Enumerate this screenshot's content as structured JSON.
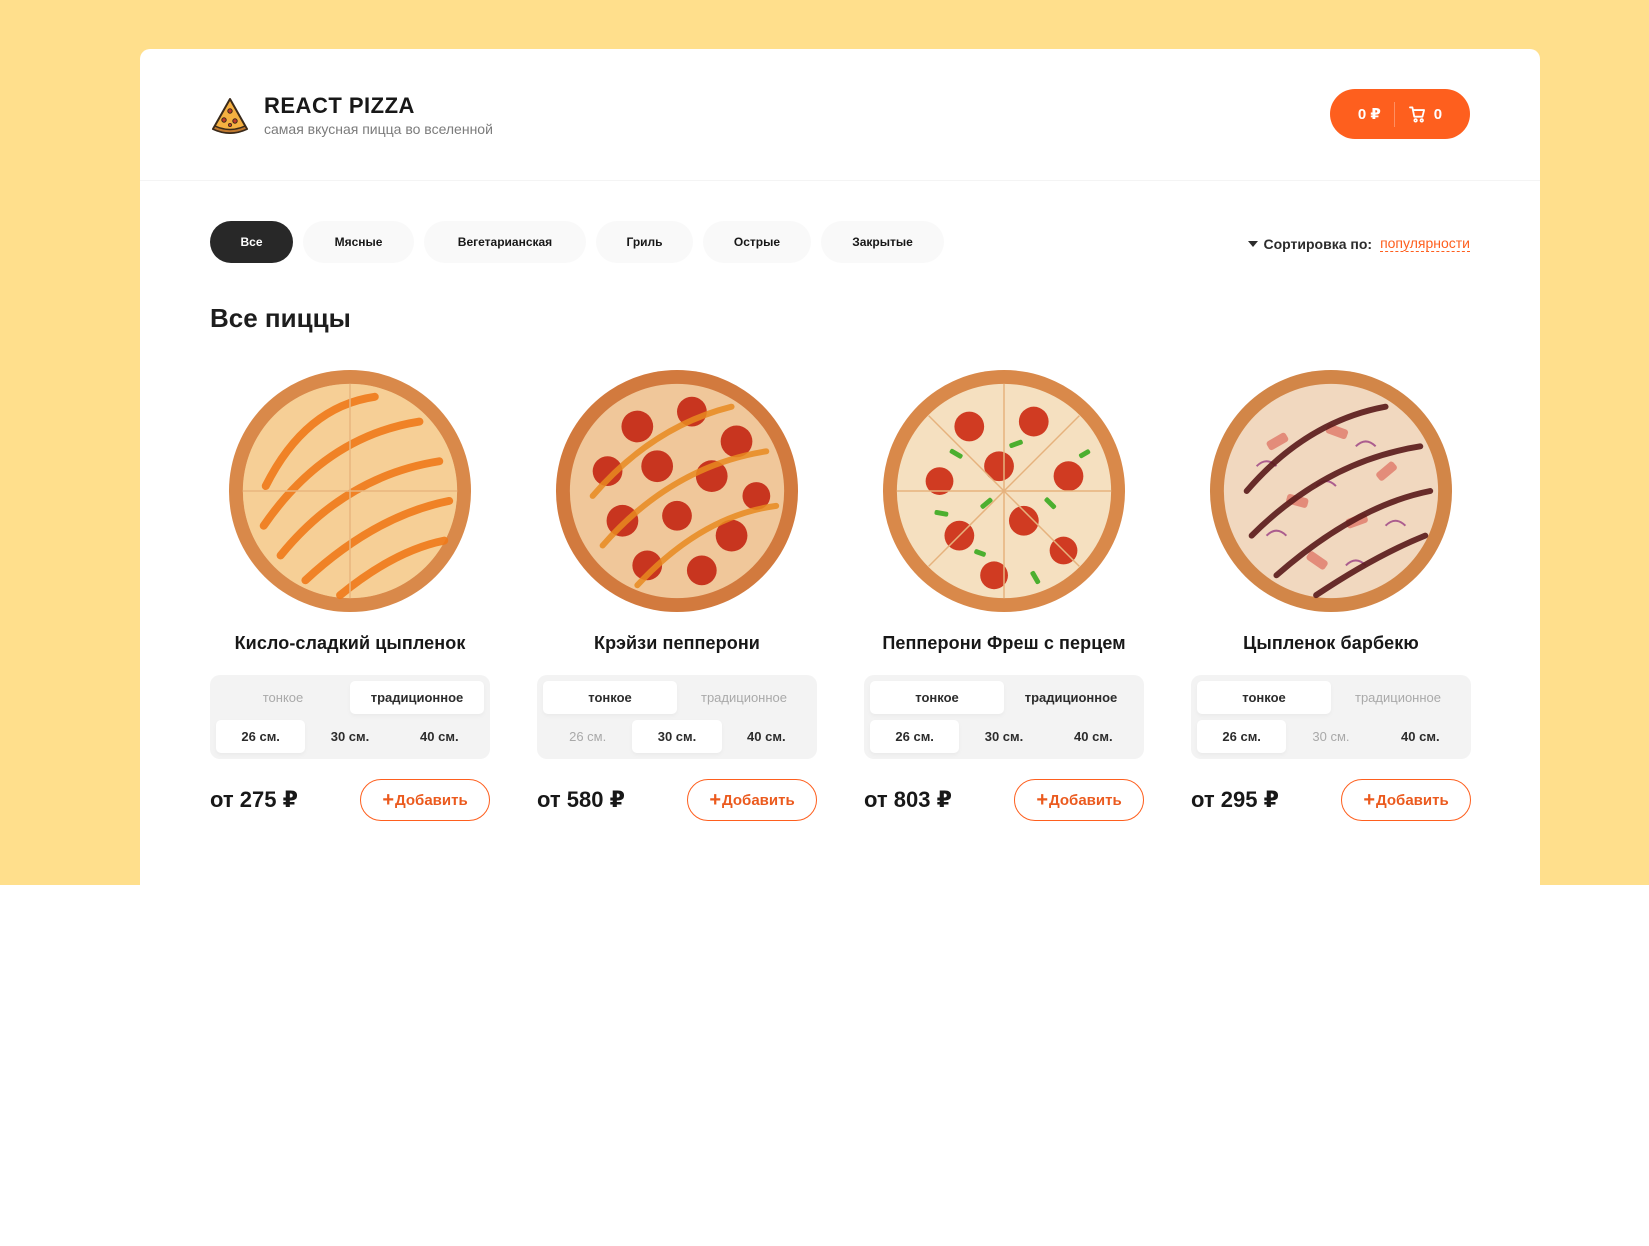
{
  "brand": {
    "title": "REACT PIZZA",
    "subtitle": "самая вкусная пицца во вселенной",
    "icon": "pizza-slice-icon"
  },
  "cart": {
    "price": "0 ₽",
    "count": "0",
    "icon": "cart-icon"
  },
  "categories": [
    "Все",
    "Мясные",
    "Вегетарианская",
    "Гриль",
    "Острые",
    "Закрытые"
  ],
  "active_category": "Все",
  "sort": {
    "label": "Сортировка по:",
    "value": "популярности",
    "icon": "caret-down-icon"
  },
  "section_title": "Все пиццы",
  "option_labels": {
    "types": [
      "тонкое",
      "традиционное"
    ],
    "sizes": [
      "26 см.",
      "30 см.",
      "40 см."
    ],
    "add": "Добавить",
    "add_icon": "plus-icon"
  },
  "pizzas": [
    {
      "title": "Кисло-сладкий цыпленок",
      "price": "от 275 ₽",
      "type_state": [
        "disabled",
        "active"
      ],
      "size_state": [
        "active",
        "normal",
        "normal"
      ],
      "style": "sweet-sour"
    },
    {
      "title": "Крэйзи пепперони",
      "price": "от 580 ₽",
      "type_state": [
        "active",
        "disabled"
      ],
      "size_state": [
        "disabled",
        "active",
        "normal"
      ],
      "style": "pepperoni"
    },
    {
      "title": "Пепперони Фреш с перцем",
      "price": "от 803 ₽",
      "type_state": [
        "active",
        "normal"
      ],
      "size_state": [
        "active",
        "normal",
        "normal"
      ],
      "style": "pepper"
    },
    {
      "title": "Цыпленок барбекю",
      "price": "от 295 ₽",
      "type_state": [
        "active",
        "disabled"
      ],
      "size_state": [
        "active",
        "disabled",
        "normal"
      ],
      "style": "bbq"
    }
  ],
  "colors": {
    "background": "#ffdf8c",
    "accent": "#fe5f1e",
    "dark": "#282828"
  }
}
